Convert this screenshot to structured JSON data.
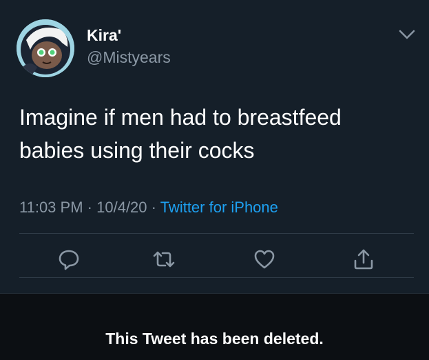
{
  "tweet": {
    "display_name": "Kira'",
    "handle": "@Mistyears",
    "text": "Imagine if men had to breastfeed babies using their cocks",
    "time": "11:03 PM",
    "separator": "·",
    "date": "10/4/20",
    "source": "Twitter for iPhone"
  },
  "actions": {
    "reply_icon": "reply-icon",
    "retweet_icon": "retweet-icon",
    "like_icon": "heart-icon",
    "share_icon": "share-icon"
  },
  "notice": {
    "deleted": "This Tweet has been deleted."
  },
  "colors": {
    "background": "#151f29",
    "secondary_text": "#8b98a5",
    "link": "#1da1f2",
    "notice_bg": "#0c0f13"
  }
}
